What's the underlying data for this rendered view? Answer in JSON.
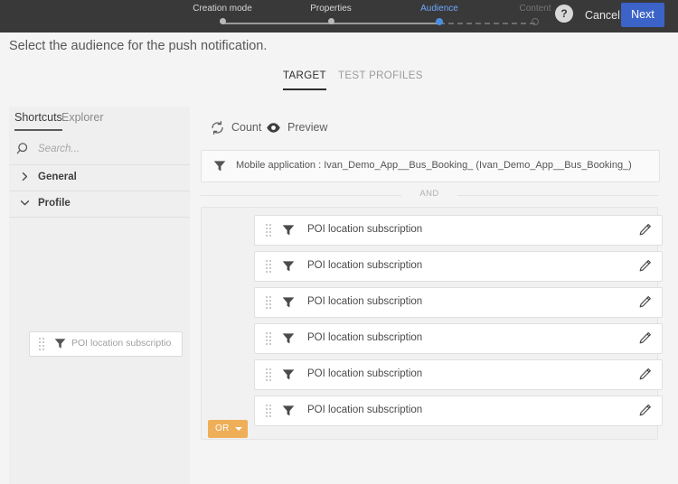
{
  "header": {
    "steps": [
      {
        "label": "Creation mode",
        "state": "done"
      },
      {
        "label": "Properties",
        "state": "done"
      },
      {
        "label": "Audience",
        "state": "current"
      },
      {
        "label": "Content",
        "state": "future"
      }
    ],
    "help_icon": "help-question-icon",
    "help_glyph": "?",
    "cancel_label": "Cancel",
    "next_label": "Next",
    "bar_color": "#393939",
    "next_color": "#3b63c8",
    "current_step_color": "#4a90e2"
  },
  "page": {
    "title": "Select the audience for the push notification."
  },
  "tabs": [
    {
      "label": "TARGET",
      "active": true
    },
    {
      "label": "TEST PROFILES",
      "active": false
    }
  ],
  "sidebar": {
    "tabs": [
      {
        "label": "Shortcuts",
        "active": true
      },
      {
        "label": "Explorer",
        "active": false
      }
    ],
    "search": {
      "icon": "search-icon",
      "value": "",
      "placeholder": "Search..."
    },
    "groups": [
      {
        "label": "General",
        "expanded": false,
        "caret": "›"
      },
      {
        "label": "Profile",
        "expanded": true,
        "caret": "⌄"
      }
    ],
    "card": {
      "icon": "funnel-icon",
      "grip": "drag-handle-icon",
      "label": "POI location subscriptio…"
    }
  },
  "main": {
    "actions": [
      {
        "label": "Count",
        "icon": "refresh-icon"
      },
      {
        "label": "Preview",
        "icon": "eye-icon"
      }
    ],
    "filter_bar": {
      "icon": "funnel-icon",
      "text": "Mobile application : Ivan_Demo_App__Bus_Booking_  (Ivan_Demo_App__Bus_Booking_)"
    },
    "operator_divider": "AND",
    "or_group": {
      "operator_label": "OR",
      "operator_color": "#efae58",
      "rows": [
        {
          "label": "POI location subscription",
          "icon": "funnel-icon",
          "grip": "drag-handle-icon",
          "edit": "pencil-icon"
        },
        {
          "label": "POI location subscription",
          "icon": "funnel-icon",
          "grip": "drag-handle-icon",
          "edit": "pencil-icon"
        },
        {
          "label": "POI location subscription",
          "icon": "funnel-icon",
          "grip": "drag-handle-icon",
          "edit": "pencil-icon"
        },
        {
          "label": "POI location subscription",
          "icon": "funnel-icon",
          "grip": "drag-handle-icon",
          "edit": "pencil-icon"
        },
        {
          "label": "POI location subscription",
          "icon": "funnel-icon",
          "grip": "drag-handle-icon",
          "edit": "pencil-icon"
        },
        {
          "label": "POI location subscription",
          "icon": "funnel-icon",
          "grip": "drag-handle-icon",
          "edit": "pencil-icon"
        }
      ]
    }
  }
}
